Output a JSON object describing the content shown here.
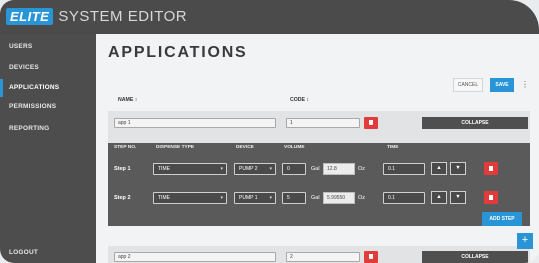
{
  "header": {
    "logo_badge": "ELITE",
    "title": "SYSTEM EDITOR"
  },
  "sidebar": {
    "items": [
      {
        "label": "USERS"
      },
      {
        "label": "DEVICES"
      },
      {
        "label": "APPLICATIONS",
        "active": true
      },
      {
        "label": "PERMISSIONS"
      },
      {
        "label": "REPORTING"
      }
    ],
    "logout": "LOGOUT"
  },
  "page": {
    "title": "APPLICATIONS",
    "cancel_label": "CANCEL",
    "save_label": "SAVE",
    "more_label": "⋮",
    "name_header": "NAME",
    "code_header": "CODE"
  },
  "apps": [
    {
      "name": "app 1",
      "code": "1",
      "collapse_label": "COLLAPSE",
      "steps_headers": [
        "STEP NO.",
        "DISPENSE TYPE",
        "DEVICE",
        "VOLUME",
        "TIME"
      ],
      "steps": [
        {
          "label": "Step 1",
          "dispense_type": "TIME",
          "device": "PUMP 2",
          "volume": "0",
          "gal": "12.8",
          "time": "0.1"
        },
        {
          "label": "Step 2",
          "dispense_type": "TIME",
          "device": "PUMP 1",
          "volume": "5",
          "gal": "5.99550",
          "time": "0.1"
        }
      ],
      "add_step_label": "ADD STEP"
    },
    {
      "name": "app 2",
      "code": "2",
      "collapse_label": "COLLAPSE"
    }
  ],
  "units": {
    "gal": "Gal",
    "oz": "Oz"
  },
  "sort_icon_text": "↕",
  "fab_label": "+",
  "colors": {
    "accent": "#2a95d6",
    "danger": "#e23b3b",
    "sidebar": "#4d4d4d"
  }
}
